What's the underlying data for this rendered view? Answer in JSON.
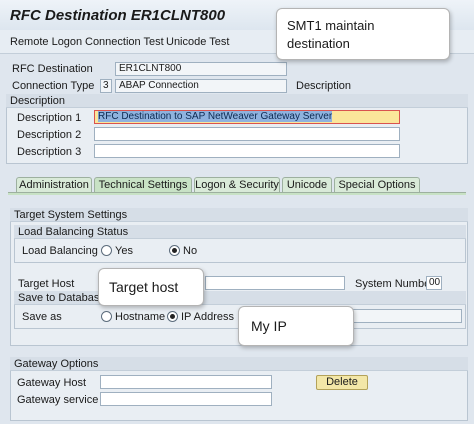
{
  "window": {
    "title": "RFC Destination ER1CLNT800"
  },
  "menu": [
    "Remote Logon",
    "Connection Test",
    "Unicode Test"
  ],
  "header": {
    "rfc_dest_label": "RFC Destination",
    "rfc_dest_value": "ER1CLNT800",
    "conn_type_label": "Connection Type",
    "conn_type_code": "3",
    "conn_type_value": "ABAP Connection",
    "conn_type_desc_label": "Description"
  },
  "description": {
    "title": "Description",
    "d1_label": "Description 1",
    "d1_value": "RFC Destination to SAP NetWeaver Gateway Server",
    "d2_label": "Description 2",
    "d3_label": "Description 3"
  },
  "tabs": [
    "Administration",
    "Technical Settings",
    "Logon & Security",
    "Unicode",
    "Special Options"
  ],
  "target": {
    "title": "Target System Settings",
    "lb_title": "Load Balancing Status",
    "lb_label": "Load Balancing",
    "yes": "Yes",
    "no": "No",
    "target_host_label": "Target Host",
    "sysnum_label": "System Number",
    "sysnum_value": "00",
    "save_db_title": "Save to Database as",
    "save_as_label": "Save as",
    "hostname": "Hostname",
    "ip": "IP Address"
  },
  "gateway": {
    "title": "Gateway Options",
    "host_label": "Gateway Host",
    "service_label": "Gateway service",
    "delete_label": "Delete"
  },
  "callouts": {
    "smt1": "SMT1 maintain destination",
    "target_host": "Target host",
    "my_ip": "My IP"
  }
}
